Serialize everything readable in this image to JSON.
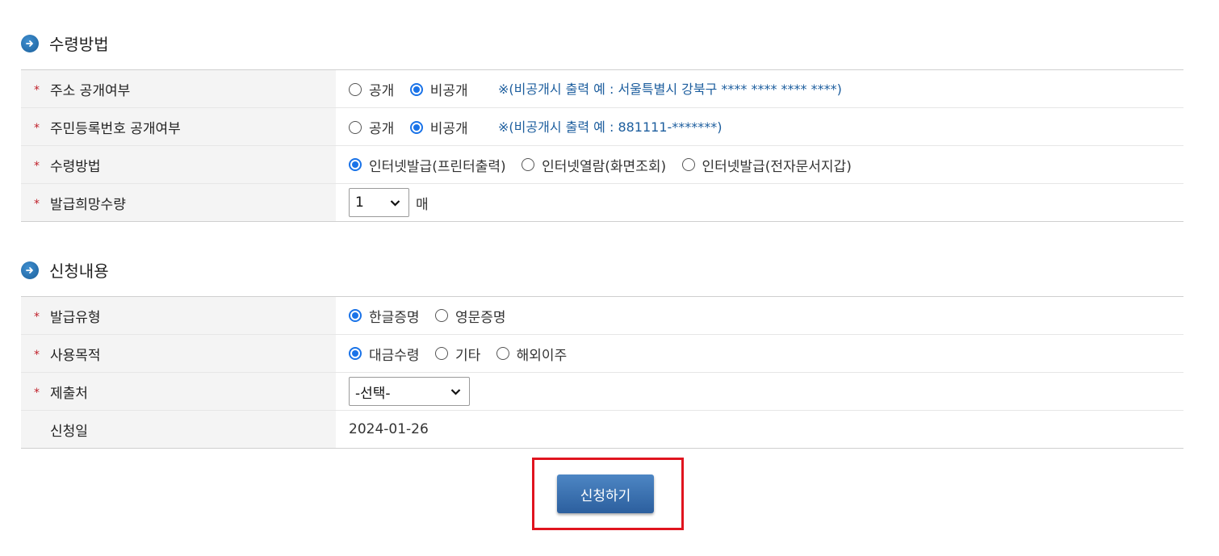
{
  "receipt_section": {
    "title": "수령방법",
    "rows": {
      "address_disclosure": {
        "label": "주소 공개여부",
        "options": [
          "공개",
          "비공개"
        ],
        "selected": "비공개",
        "note": "※(비공개시 출력 예 : 서울특별시 강북구 **** **** **** ****)"
      },
      "rrn_disclosure": {
        "label": "주민등록번호 공개여부",
        "options": [
          "공개",
          "비공개"
        ],
        "selected": "비공개",
        "note": "※(비공개시 출력 예 : 881111-*******)"
      },
      "receipt_method": {
        "label": "수령방법",
        "options": [
          "인터넷발급(프린터출력)",
          "인터넷열람(화면조회)",
          "인터넷발급(전자문서지갑)"
        ],
        "selected": "인터넷발급(프린터출력)"
      },
      "quantity": {
        "label": "발급희망수량",
        "value": "1",
        "unit": "매"
      }
    }
  },
  "request_section": {
    "title": "신청내용",
    "rows": {
      "issue_type": {
        "label": "발급유형",
        "options": [
          "한글증명",
          "영문증명"
        ],
        "selected": "한글증명"
      },
      "purpose": {
        "label": "사용목적",
        "options": [
          "대금수령",
          "기타",
          "해외이주"
        ],
        "selected": "대금수령"
      },
      "submit_to": {
        "label": "제출처",
        "value": "-선택-"
      },
      "request_date": {
        "label": "신청일",
        "value": "2024-01-26"
      }
    }
  },
  "submit_button": {
    "label": "신청하기"
  },
  "colors": {
    "accent": "#1a73e8",
    "required": "#c0202a",
    "note": "#1d5e9e",
    "highlight_border": "#e0141f",
    "button": "#2c5f9e"
  }
}
